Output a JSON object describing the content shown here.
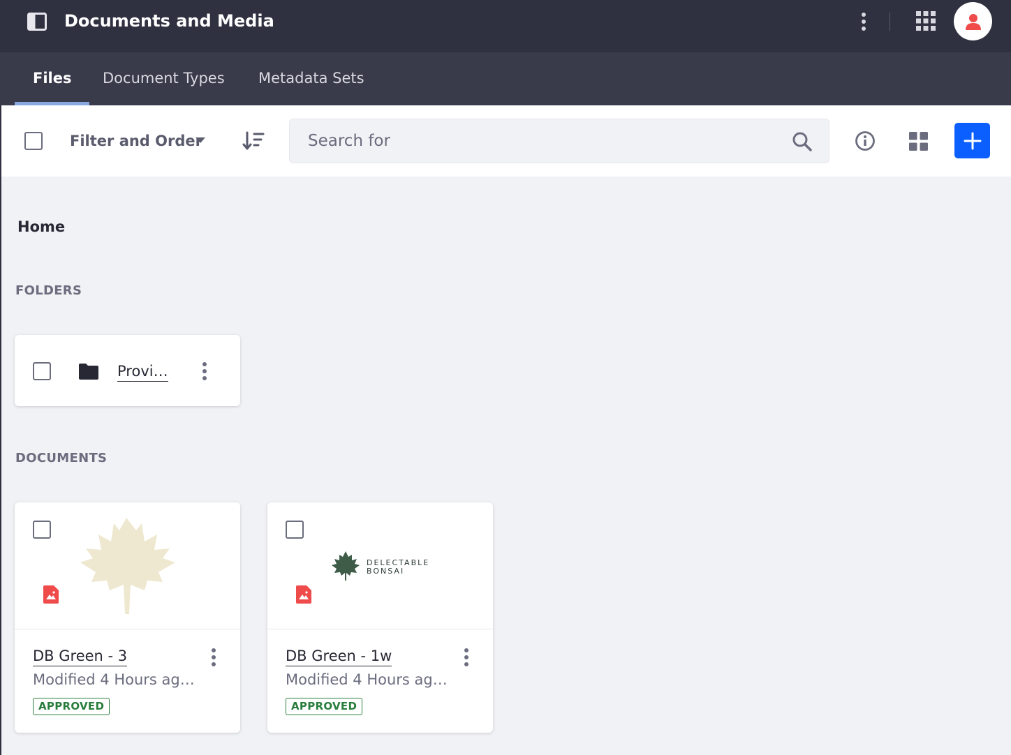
{
  "header": {
    "app_title": "Documents and Media",
    "icons": [
      "product-menu-icon",
      "kebab-icon",
      "apps-grid-icon",
      "user-avatar-icon"
    ],
    "colors": {
      "bar": "#2f3040",
      "avatar_icon": "#ef4b4b"
    }
  },
  "tabs": [
    {
      "label": "Files",
      "active": true
    },
    {
      "label": "Document Types",
      "active": false
    },
    {
      "label": "Metadata Sets",
      "active": false
    }
  ],
  "toolbar": {
    "filter_label": "Filter and Order",
    "search_placeholder": "Search for",
    "icons": [
      "sort-icon",
      "search-icon",
      "info-icon",
      "cards-view-icon",
      "plus-icon"
    ],
    "add_button_color": "#0b5fff"
  },
  "breadcrumb": {
    "current": "Home"
  },
  "folders": {
    "section_label": "FOLDERS",
    "items": [
      {
        "name": "Provi…"
      }
    ]
  },
  "documents": {
    "section_label": "DOCUMENTS",
    "items": [
      {
        "title": "DB Green - 3",
        "subtitle": "Modified 4 Hours ag…",
        "status": "APPROVED"
      },
      {
        "title": "DB Green - 1w",
        "subtitle": "Modified 4 Hours ag…",
        "status": "APPROVED",
        "thumbnail_text": [
          "DELECTABLE",
          "BONSAI"
        ]
      }
    ],
    "status_color": "#287d3c"
  }
}
